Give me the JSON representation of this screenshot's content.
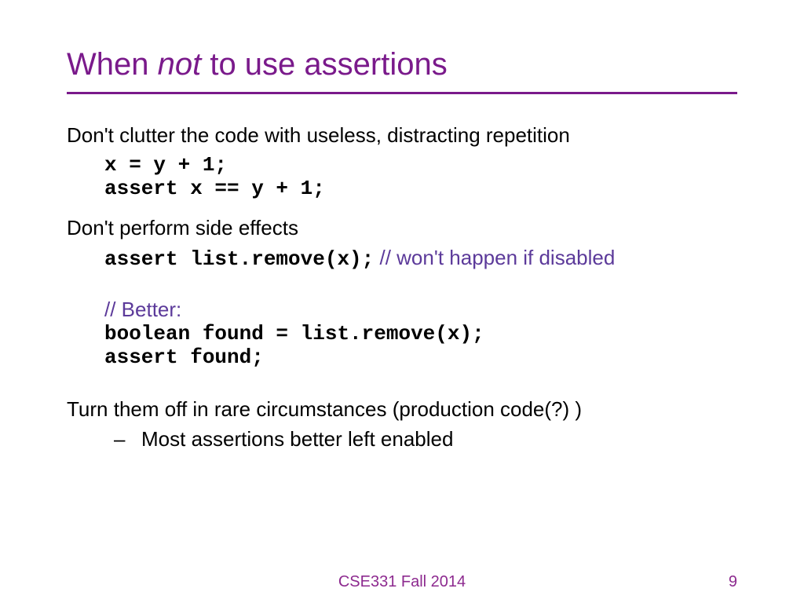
{
  "title": {
    "part1": "When ",
    "italic": "not",
    "part2": " to use assertions"
  },
  "line1": "Don't clutter the code with useless, distracting repetition",
  "code1": "x = y + 1;",
  "code2": "assert x == y + 1;",
  "line2": "Don't perform side effects",
  "code3": "assert list.remove(x);",
  "comment1": "  // won't happen if disabled",
  "comment2": "// Better:",
  "code4": "boolean found = list.remove(x);",
  "code5": "assert found;",
  "line3": "Turn them off in rare circumstances (production code(?) )",
  "bullet1": "Most assertions better left enabled",
  "footer": {
    "course": "CSE331 Fall 2014",
    "page": "9"
  }
}
